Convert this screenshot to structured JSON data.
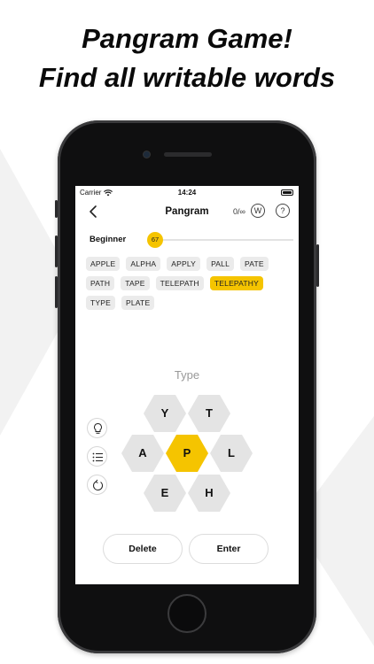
{
  "headline": {
    "line1": "Pangram Game!",
    "line2": "Find all writable words"
  },
  "status_bar": {
    "carrier": "Carrier",
    "time": "14:24"
  },
  "nav": {
    "title": "Pangram",
    "count": "0/∞",
    "w_label": "W",
    "help_label": "?"
  },
  "level": {
    "name": "Beginner",
    "score": "67",
    "progress_fraction": 0.0
  },
  "found_words": [
    {
      "text": "APPLE",
      "highlight": false
    },
    {
      "text": "ALPHA",
      "highlight": false
    },
    {
      "text": "APPLY",
      "highlight": false
    },
    {
      "text": "PALL",
      "highlight": false
    },
    {
      "text": "PATE",
      "highlight": false
    },
    {
      "text": "PATH",
      "highlight": false
    },
    {
      "text": "TAPE",
      "highlight": false
    },
    {
      "text": "TELEPATH",
      "highlight": false
    },
    {
      "text": "TELEPATHY",
      "highlight": true
    },
    {
      "text": "TYPE",
      "highlight": false
    },
    {
      "text": "PLATE",
      "highlight": false
    }
  ],
  "input": {
    "placeholder": "Type"
  },
  "letters": {
    "top_left": "Y",
    "top_right": "T",
    "mid_left": "A",
    "center": "P",
    "mid_right": "L",
    "bottom_left": "E",
    "bottom_right": "H"
  },
  "side_tools": {
    "icons": [
      "lightbulb-icon",
      "list-icon",
      "shuffle-icon"
    ]
  },
  "actions": {
    "delete_label": "Delete",
    "enter_label": "Enter"
  },
  "colors": {
    "accent": "#f5c400",
    "hex_default": "#e4e4e4",
    "chip_bg": "#ebebeb"
  }
}
